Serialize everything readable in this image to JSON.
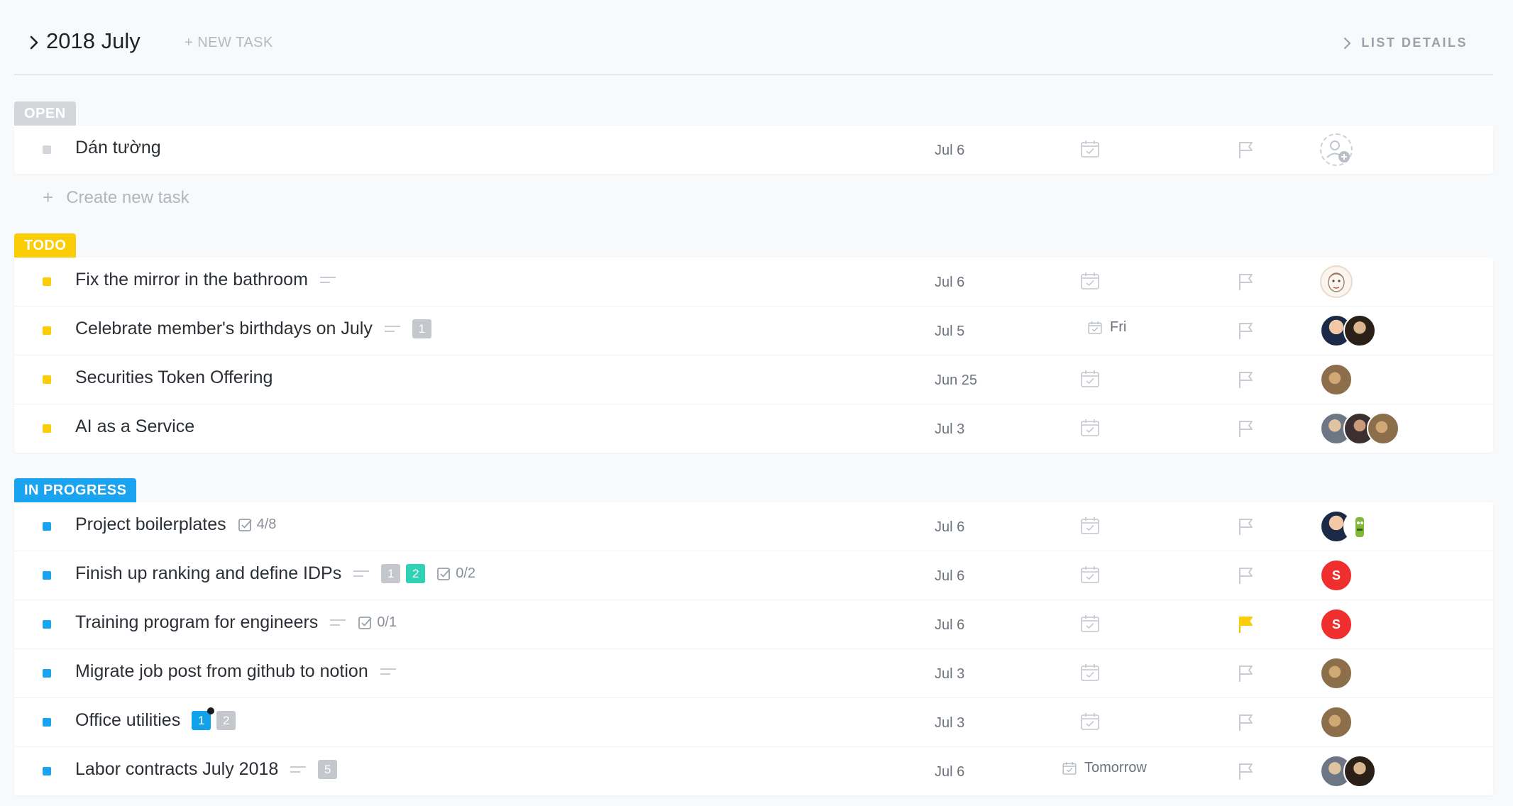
{
  "header": {
    "title": "2018 July",
    "new_task": "+ NEW TASK",
    "list_details": "LIST DETAILS"
  },
  "colors": {
    "open": "#d3d6db",
    "todo": "#fbcd07",
    "in_progress": "#1aa3f0",
    "flag_active": "#fbcd07",
    "avatar_red": "#ef2e2e"
  },
  "groups": {
    "open": {
      "label": "OPEN",
      "tasks": [
        {
          "name": "Dán tường",
          "date": "Jul 6"
        }
      ],
      "create_new": "Create new task"
    },
    "todo": {
      "label": "TODO",
      "tasks": [
        {
          "name": "Fix the mirror in the bathroom",
          "date": "Jul 6"
        },
        {
          "name": "Celebrate member's birthdays on July",
          "badge": "1",
          "date": "Jul 5",
          "due": "Fri"
        },
        {
          "name": "Securities Token Offering",
          "date": "Jun 25"
        },
        {
          "name": "AI as a Service",
          "date": "Jul 3"
        }
      ]
    },
    "in_progress": {
      "label": "IN PROGRESS",
      "tasks": [
        {
          "name": "Project boilerplates",
          "checklist": "4/8",
          "date": "Jul 6"
        },
        {
          "name": "Finish up ranking and define IDPs",
          "badge1": "1",
          "badge2": "2",
          "checklist": "0/2",
          "date": "Jul 6",
          "assignee_initial": "S"
        },
        {
          "name": "Training program for engineers",
          "checklist": "0/1",
          "date": "Jul 6",
          "assignee_initial": "S"
        },
        {
          "name": "Migrate job post from github to notion",
          "date": "Jul 3"
        },
        {
          "name": "Office utilities",
          "badge1": "1",
          "badge2": "2",
          "date": "Jul 3"
        },
        {
          "name": "Labor contracts July 2018",
          "badge": "5",
          "date": "Jul 6",
          "due": "Tomorrow"
        }
      ]
    }
  },
  "icons": [
    "chevron-right-icon",
    "calendar-check-icon",
    "flag-icon",
    "description-icon",
    "checklist-icon",
    "add-user-icon",
    "plus-icon"
  ]
}
